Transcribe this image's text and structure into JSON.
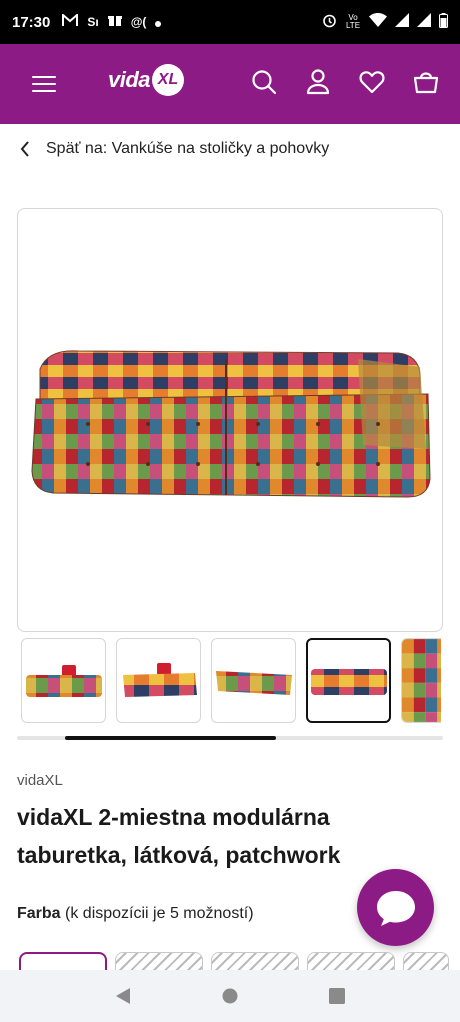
{
  "status_bar": {
    "time": "17:30",
    "left_icons": [
      "gmail-icon",
      "notification-icon",
      "gift-icon",
      "email-icon",
      "dot-icon"
    ],
    "left_texts": [
      "M",
      "Sı",
      "@(",
      "•"
    ],
    "right_icons": [
      "alarm-icon",
      "volte-icon",
      "wifi-icon",
      "signal-icon",
      "signal-icon",
      "battery-icon"
    ],
    "volte_label": "Vo LTE"
  },
  "header": {
    "logo_text": "vida",
    "logo_badge": "XL",
    "icons": [
      "menu-icon",
      "search-icon",
      "account-icon",
      "wishlist-icon",
      "cart-icon"
    ],
    "brand_color": "#8d1b86"
  },
  "breadcrumb": {
    "label": "Späť na: Vankúše na stoličky a pohovky"
  },
  "product": {
    "brand": "vidaXL",
    "title": "vidaXL 2-miestna modulárna taburetka, látková, patchwork",
    "color_label": "Farba",
    "color_availability": "(k dispozícii je 5 možností)",
    "thumbnail_count_visible": 5,
    "active_thumbnail_index": 3
  },
  "swatches": {
    "count_visible": 5,
    "active_index": 0
  },
  "navbar": {
    "icons": [
      "back-icon",
      "home-icon",
      "recents-icon"
    ]
  }
}
